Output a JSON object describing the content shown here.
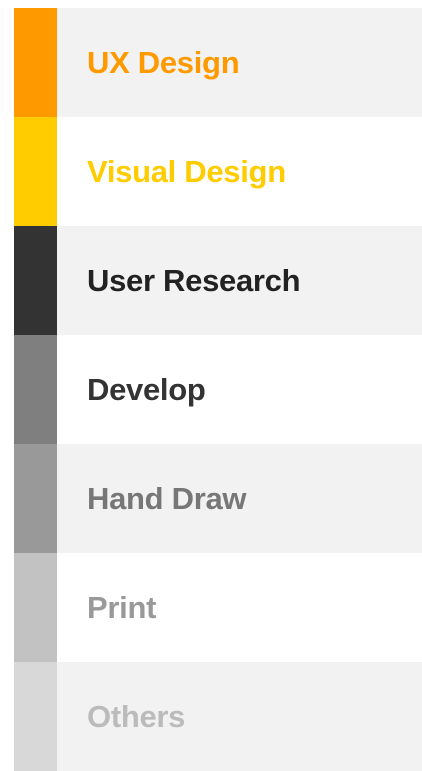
{
  "nav": {
    "items": [
      {
        "label": "UX Design",
        "swatch_color": "#ff9900",
        "text_color": "#ff9900",
        "background": "shaded"
      },
      {
        "label": "Visual Design",
        "swatch_color": "#ffcc00",
        "text_color": "#ffcc00",
        "background": "white"
      },
      {
        "label": "User Research",
        "swatch_color": "#333333",
        "text_color": "#222222",
        "background": "shaded"
      },
      {
        "label": "Develop",
        "swatch_color": "#7f7f7f",
        "text_color": "#333333",
        "background": "white"
      },
      {
        "label": "Hand Draw",
        "swatch_color": "#999999",
        "text_color": "#777777",
        "background": "shaded"
      },
      {
        "label": "Print",
        "swatch_color": "#c2c2c2",
        "text_color": "#999999",
        "background": "white"
      },
      {
        "label": "Others",
        "swatch_color": "#d8d8d8",
        "text_color": "#bbbbbb",
        "background": "shaded"
      }
    ]
  }
}
